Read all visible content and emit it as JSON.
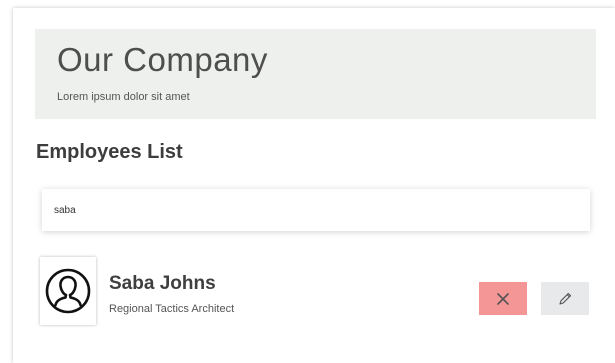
{
  "header": {
    "title": "Our Company",
    "subtitle": "Lorem ipsum dolor sit amet"
  },
  "employees_section": {
    "title": "Employees List",
    "search": {
      "value": "saba",
      "placeholder": ""
    }
  },
  "employees": [
    {
      "name": "Saba Johns",
      "role": "Regional Tactics Architect",
      "avatar_icon": "user-silhouette-icon"
    }
  ],
  "actions": {
    "delete_icon": "close-icon",
    "edit_icon": "pencil-icon"
  },
  "colors": {
    "header_background": "#eef0ed",
    "delete_button": "#f59696",
    "edit_button": "#e8e9ea"
  }
}
